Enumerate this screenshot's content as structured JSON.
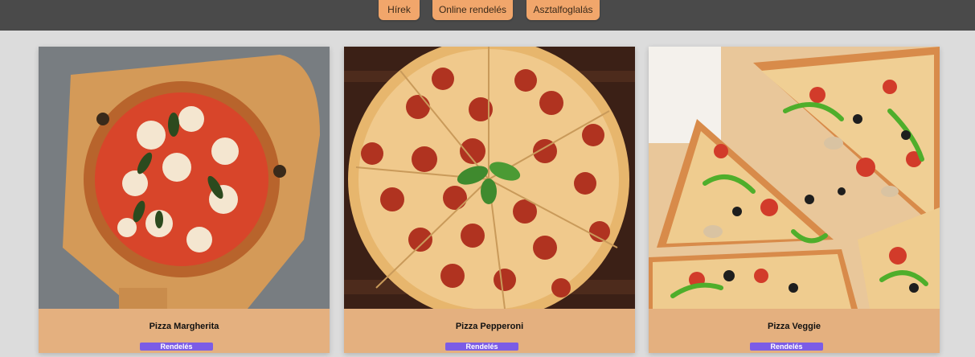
{
  "nav": {
    "items": [
      {
        "label": "Hírek"
      },
      {
        "label": "Online rendelés"
      },
      {
        "label": "Asztalfoglalás"
      }
    ]
  },
  "products": [
    {
      "name": "Pizza Margherita",
      "button": "Rendelés",
      "image": "pizza-margherita-photo"
    },
    {
      "name": "Pizza Pepperoni",
      "button": "Rendelés",
      "image": "pizza-pepperoni-photo"
    },
    {
      "name": "Pizza Veggie",
      "button": "Rendelés",
      "image": "pizza-veggie-photo"
    }
  ],
  "colors": {
    "header_bg": "#4a4a4a",
    "nav_button": "#f1a66b",
    "card_bg": "#e4b07f",
    "order_button": "#7b5ce6",
    "page_bg": "#dcdcdc"
  }
}
